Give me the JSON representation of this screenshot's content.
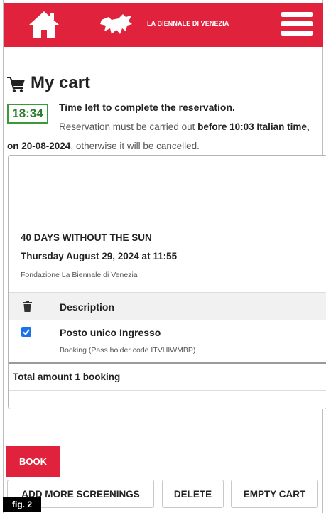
{
  "header": {
    "brand": "LA BIENNALE DI VENEZIA",
    "brand_color": "#e0223c",
    "icons": [
      "home-icon",
      "lion-logo-icon",
      "hamburger-menu-icon"
    ]
  },
  "cart": {
    "title": "My cart",
    "timer": "18:34",
    "time_left_label": "Time left to complete the reservation.",
    "reservation_pre": "Reservation must be carried out ",
    "reservation_deadline": "before 10:03 Italian time, on 20-08-2024",
    "reservation_post": ", otherwise it will be cancelled."
  },
  "event": {
    "title": "40 DAYS WITHOUT THE SUN",
    "datetime": "Thursday August 29, 2024 at 11:55",
    "organizer": "Fondazione La Biennale di Venezia"
  },
  "table": {
    "header_description": "Description",
    "rows": [
      {
        "checked": true,
        "name": "Posto unico Ingresso",
        "note": "Booking (Pass holder code ITVHIWMBP)."
      }
    ],
    "total": "Total amount 1 booking"
  },
  "actions": {
    "book": "BOOK",
    "add_more": "ADD MORE SCREENINGS",
    "delete": "DELETE",
    "empty_cart": "EMPTY CART"
  },
  "figure_label": "fig. 2"
}
